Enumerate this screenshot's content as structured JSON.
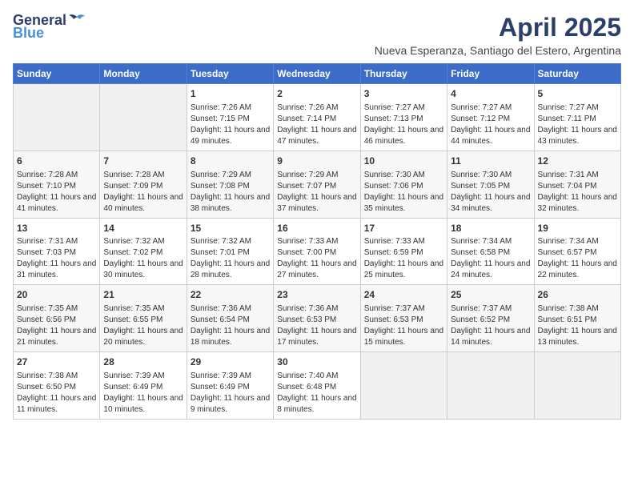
{
  "logo": {
    "general": "General",
    "blue": "Blue"
  },
  "title": {
    "month_year": "April 2025",
    "location": "Nueva Esperanza, Santiago del Estero, Argentina"
  },
  "days_of_week": [
    "Sunday",
    "Monday",
    "Tuesday",
    "Wednesday",
    "Thursday",
    "Friday",
    "Saturday"
  ],
  "weeks": [
    [
      {
        "day": "",
        "info": ""
      },
      {
        "day": "",
        "info": ""
      },
      {
        "day": "1",
        "info": "Sunrise: 7:26 AM\nSunset: 7:15 PM\nDaylight: 11 hours and 49 minutes."
      },
      {
        "day": "2",
        "info": "Sunrise: 7:26 AM\nSunset: 7:14 PM\nDaylight: 11 hours and 47 minutes."
      },
      {
        "day": "3",
        "info": "Sunrise: 7:27 AM\nSunset: 7:13 PM\nDaylight: 11 hours and 46 minutes."
      },
      {
        "day": "4",
        "info": "Sunrise: 7:27 AM\nSunset: 7:12 PM\nDaylight: 11 hours and 44 minutes."
      },
      {
        "day": "5",
        "info": "Sunrise: 7:27 AM\nSunset: 7:11 PM\nDaylight: 11 hours and 43 minutes."
      }
    ],
    [
      {
        "day": "6",
        "info": "Sunrise: 7:28 AM\nSunset: 7:10 PM\nDaylight: 11 hours and 41 minutes."
      },
      {
        "day": "7",
        "info": "Sunrise: 7:28 AM\nSunset: 7:09 PM\nDaylight: 11 hours and 40 minutes."
      },
      {
        "day": "8",
        "info": "Sunrise: 7:29 AM\nSunset: 7:08 PM\nDaylight: 11 hours and 38 minutes."
      },
      {
        "day": "9",
        "info": "Sunrise: 7:29 AM\nSunset: 7:07 PM\nDaylight: 11 hours and 37 minutes."
      },
      {
        "day": "10",
        "info": "Sunrise: 7:30 AM\nSunset: 7:06 PM\nDaylight: 11 hours and 35 minutes."
      },
      {
        "day": "11",
        "info": "Sunrise: 7:30 AM\nSunset: 7:05 PM\nDaylight: 11 hours and 34 minutes."
      },
      {
        "day": "12",
        "info": "Sunrise: 7:31 AM\nSunset: 7:04 PM\nDaylight: 11 hours and 32 minutes."
      }
    ],
    [
      {
        "day": "13",
        "info": "Sunrise: 7:31 AM\nSunset: 7:03 PM\nDaylight: 11 hours and 31 minutes."
      },
      {
        "day": "14",
        "info": "Sunrise: 7:32 AM\nSunset: 7:02 PM\nDaylight: 11 hours and 30 minutes."
      },
      {
        "day": "15",
        "info": "Sunrise: 7:32 AM\nSunset: 7:01 PM\nDaylight: 11 hours and 28 minutes."
      },
      {
        "day": "16",
        "info": "Sunrise: 7:33 AM\nSunset: 7:00 PM\nDaylight: 11 hours and 27 minutes."
      },
      {
        "day": "17",
        "info": "Sunrise: 7:33 AM\nSunset: 6:59 PM\nDaylight: 11 hours and 25 minutes."
      },
      {
        "day": "18",
        "info": "Sunrise: 7:34 AM\nSunset: 6:58 PM\nDaylight: 11 hours and 24 minutes."
      },
      {
        "day": "19",
        "info": "Sunrise: 7:34 AM\nSunset: 6:57 PM\nDaylight: 11 hours and 22 minutes."
      }
    ],
    [
      {
        "day": "20",
        "info": "Sunrise: 7:35 AM\nSunset: 6:56 PM\nDaylight: 11 hours and 21 minutes."
      },
      {
        "day": "21",
        "info": "Sunrise: 7:35 AM\nSunset: 6:55 PM\nDaylight: 11 hours and 20 minutes."
      },
      {
        "day": "22",
        "info": "Sunrise: 7:36 AM\nSunset: 6:54 PM\nDaylight: 11 hours and 18 minutes."
      },
      {
        "day": "23",
        "info": "Sunrise: 7:36 AM\nSunset: 6:53 PM\nDaylight: 11 hours and 17 minutes."
      },
      {
        "day": "24",
        "info": "Sunrise: 7:37 AM\nSunset: 6:53 PM\nDaylight: 11 hours and 15 minutes."
      },
      {
        "day": "25",
        "info": "Sunrise: 7:37 AM\nSunset: 6:52 PM\nDaylight: 11 hours and 14 minutes."
      },
      {
        "day": "26",
        "info": "Sunrise: 7:38 AM\nSunset: 6:51 PM\nDaylight: 11 hours and 13 minutes."
      }
    ],
    [
      {
        "day": "27",
        "info": "Sunrise: 7:38 AM\nSunset: 6:50 PM\nDaylight: 11 hours and 11 minutes."
      },
      {
        "day": "28",
        "info": "Sunrise: 7:39 AM\nSunset: 6:49 PM\nDaylight: 11 hours and 10 minutes."
      },
      {
        "day": "29",
        "info": "Sunrise: 7:39 AM\nSunset: 6:49 PM\nDaylight: 11 hours and 9 minutes."
      },
      {
        "day": "30",
        "info": "Sunrise: 7:40 AM\nSunset: 6:48 PM\nDaylight: 11 hours and 8 minutes."
      },
      {
        "day": "",
        "info": ""
      },
      {
        "day": "",
        "info": ""
      },
      {
        "day": "",
        "info": ""
      }
    ]
  ]
}
